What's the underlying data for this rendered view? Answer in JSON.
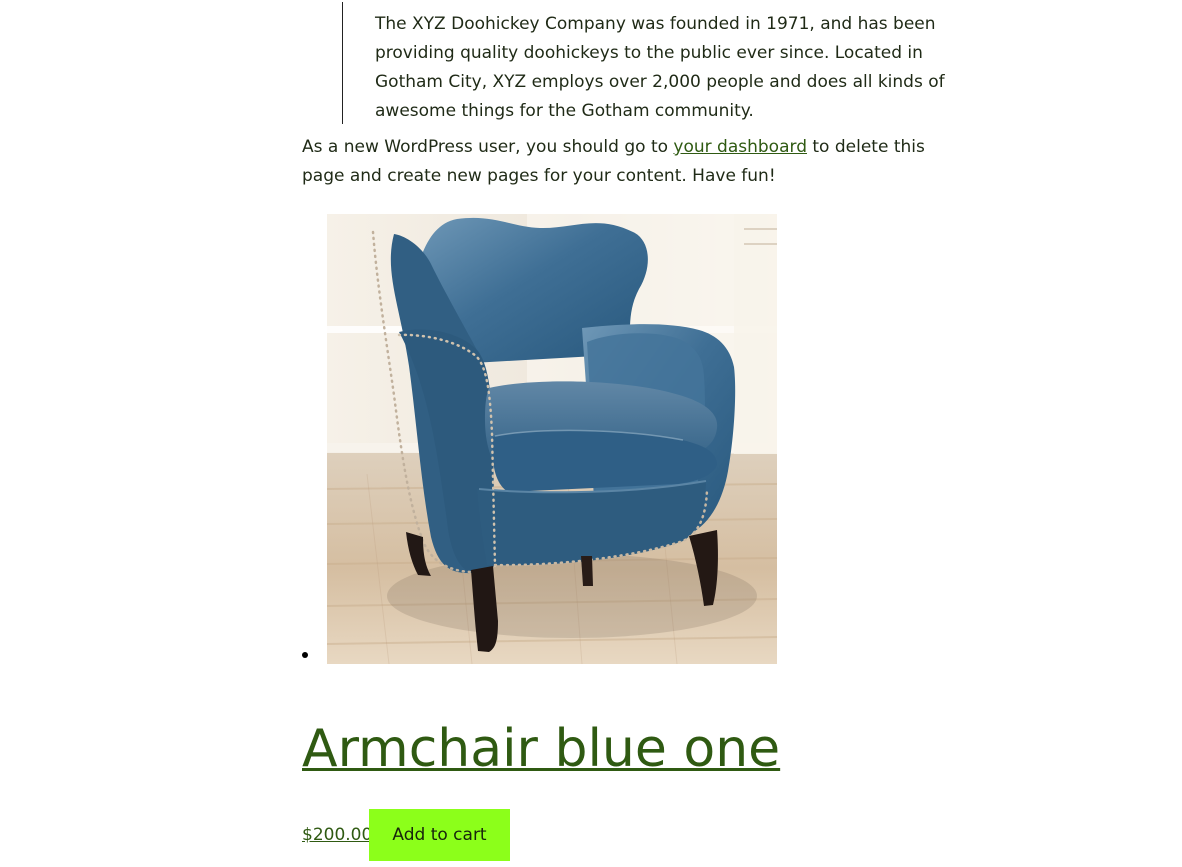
{
  "quote": {
    "text": "The XYZ Doohickey Company was founded in 1971, and has been providing quality doohickeys to the public ever since. Located in Gotham City, XYZ employs over 2,000 people and does all kinds of awesome things for the Gotham community."
  },
  "intro": {
    "before_link": "As a new WordPress user, you should go to ",
    "link_label": "your dashboard",
    "after_link": " to delete this page and create new pages for your content. Have fun!"
  },
  "product": {
    "title": "Armchair blue one",
    "price": "$200.00",
    "add_to_cart_label": "Add to cart",
    "image_icon": "blue-armchair-image"
  },
  "colors": {
    "link": "#2f5a12",
    "button": "#8cff1a"
  }
}
